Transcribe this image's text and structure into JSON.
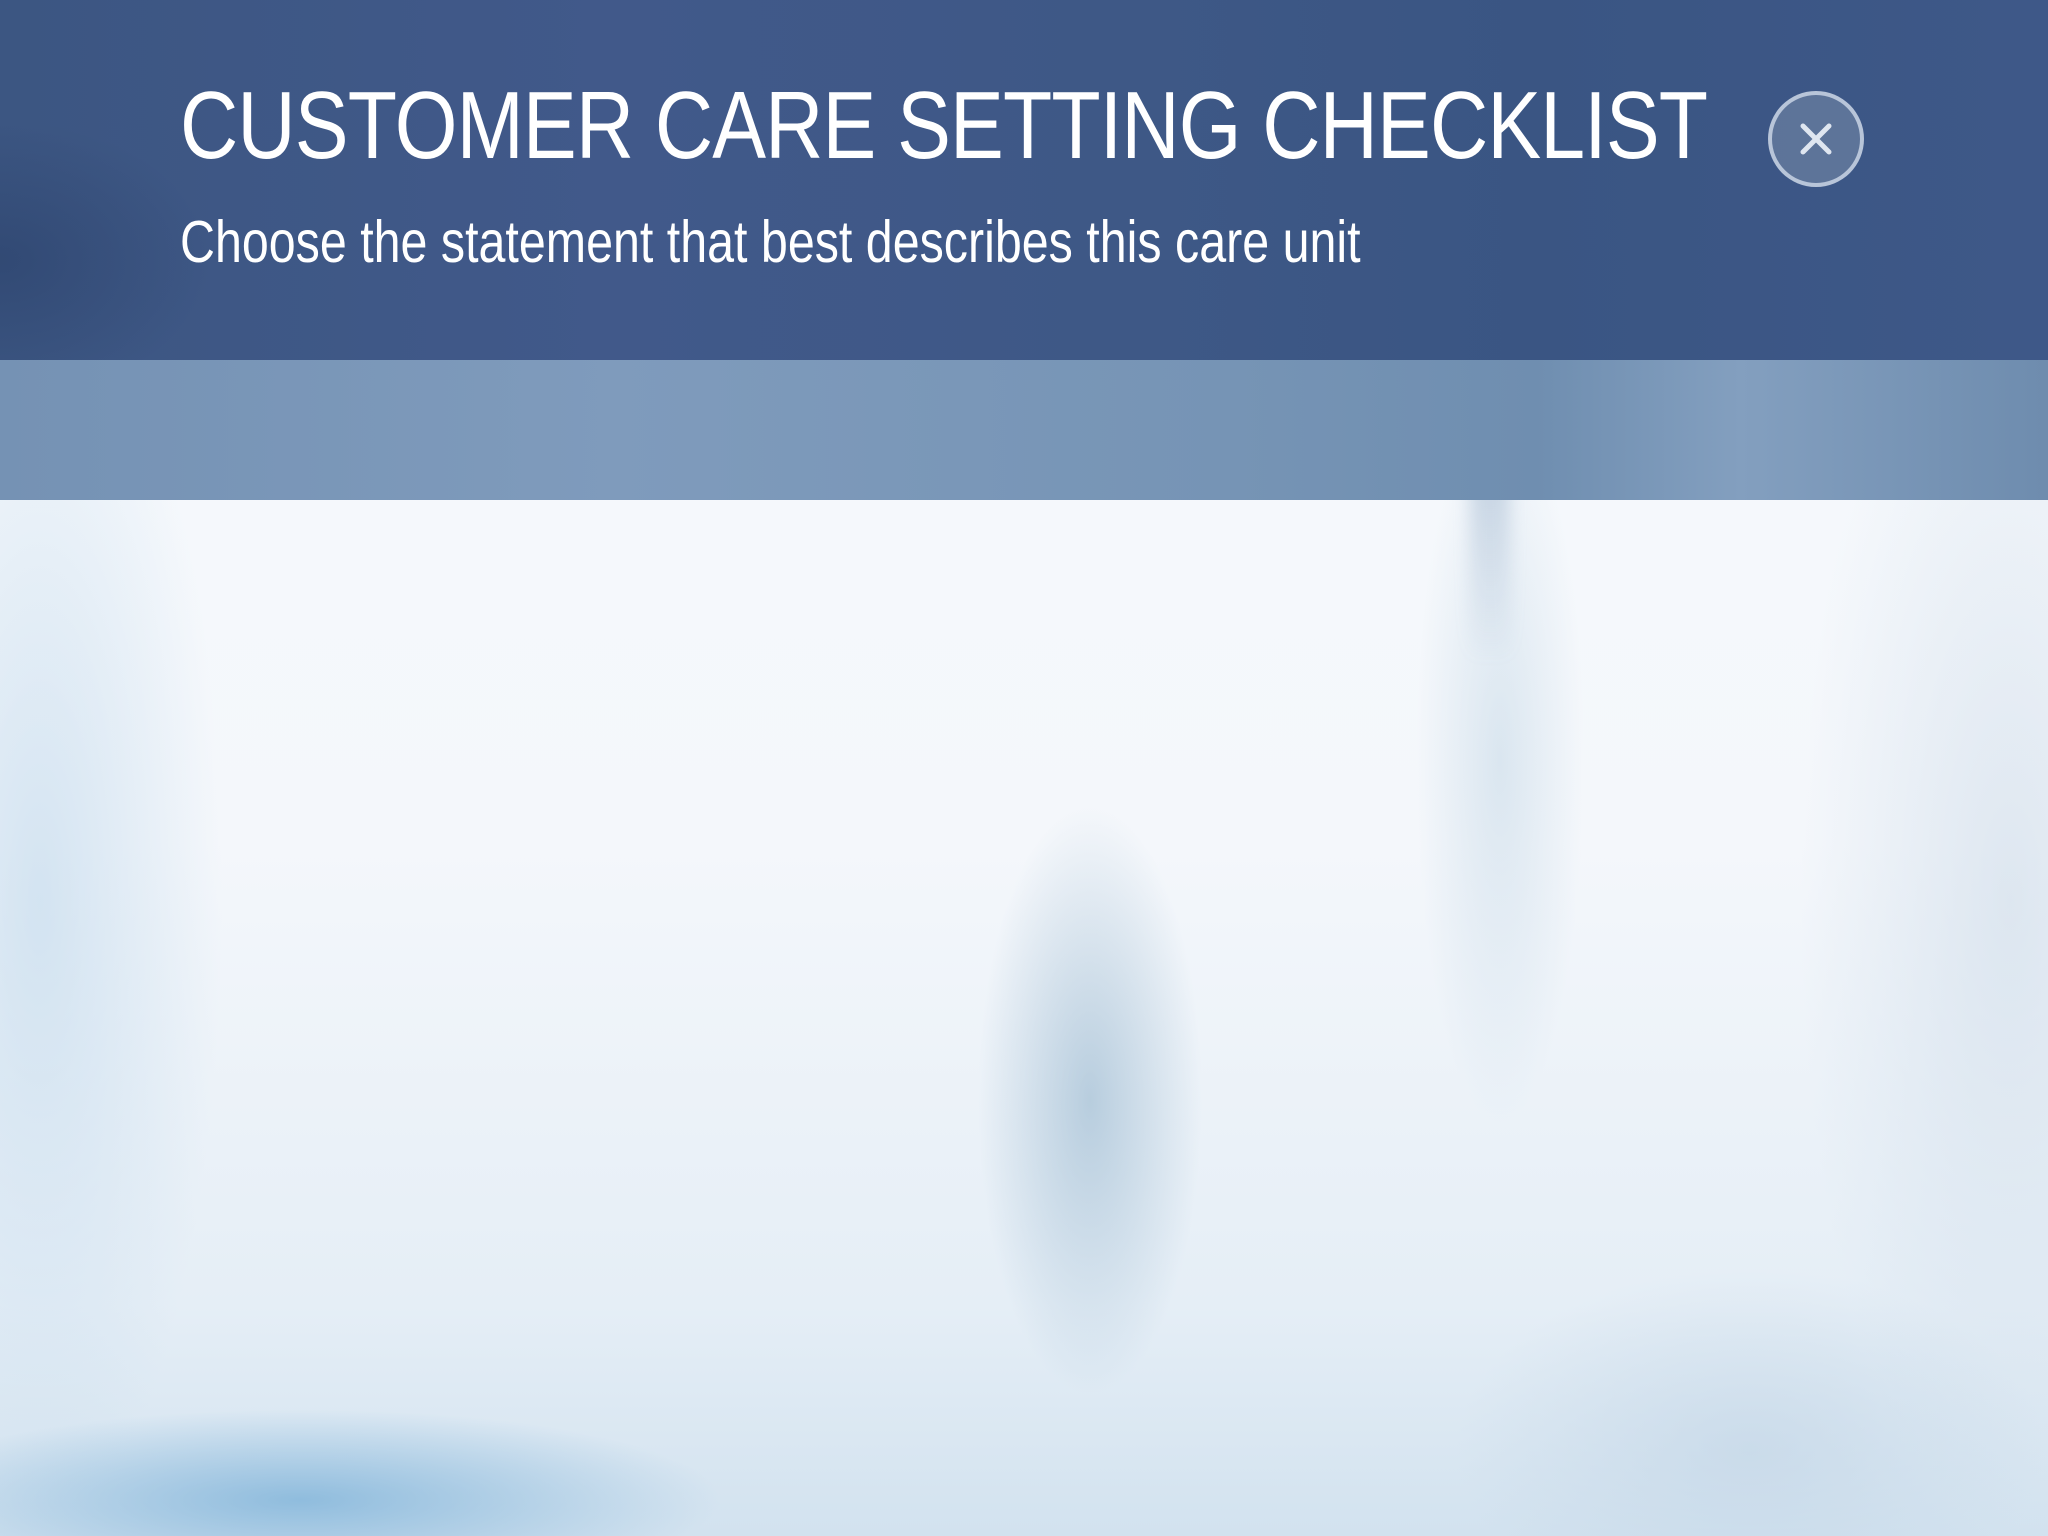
{
  "header": {
    "title": "CUSTOMER CARE SETTING CHECKLIST",
    "subtitle": "Choose the statement that best describes this care unit",
    "close_icon": "close-icon"
  },
  "colors": {
    "header_background": "#3e5886",
    "sub_band_background": "#7a96b8",
    "text": "#ffffff",
    "page_background": "#f4f7fb"
  }
}
